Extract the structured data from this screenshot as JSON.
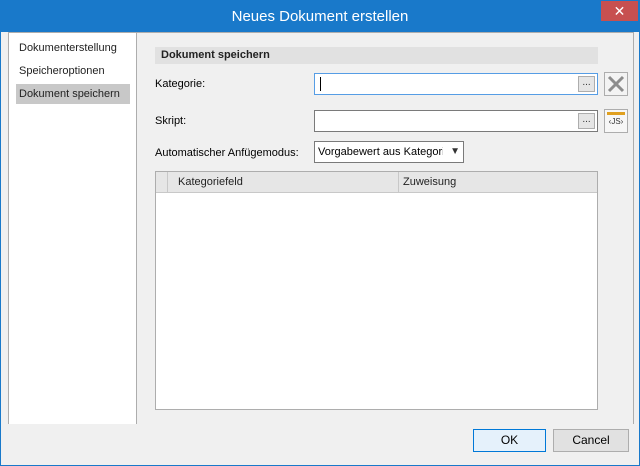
{
  "window": {
    "title": "Neues Dokument erstellen",
    "close_glyph": "✕"
  },
  "sidebar": {
    "items": [
      {
        "label": "Dokumenterstellung",
        "selected": false
      },
      {
        "label": "Speicheroptionen",
        "selected": false
      },
      {
        "label": "Dokument speichern",
        "selected": true
      }
    ]
  },
  "main": {
    "section_title": "Dokument speichern",
    "kategorie": {
      "label": "Kategorie:",
      "value": "",
      "browse_label": "..."
    },
    "skript": {
      "label": "Skript:",
      "value": "",
      "browse_label": "...",
      "js_icon_text": "‹JS›"
    },
    "append_mode": {
      "label": "Automatischer Anfügemodus:",
      "selected": "Vorgabewert aus Kategorie"
    },
    "grid": {
      "columns": [
        "Kategoriefeld",
        "Zuweisung"
      ],
      "rows": []
    }
  },
  "footer": {
    "ok_label": "OK",
    "cancel_label": "Cancel"
  },
  "colors": {
    "titlebar": "#1979ca",
    "close": "#c75050",
    "selected_nav": "#c8c8c8",
    "focus_border": "#569de5"
  }
}
